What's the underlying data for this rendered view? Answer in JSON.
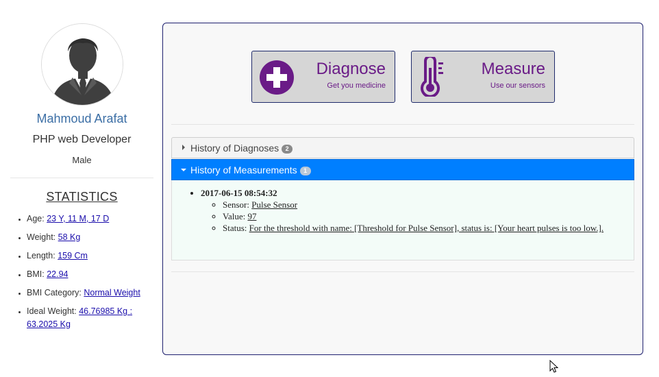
{
  "profile": {
    "name": "Mahmoud Arafat",
    "job_title": "PHP web Developer",
    "gender": "Male"
  },
  "statistics": {
    "title": "STATISTICS",
    "items": [
      {
        "label": "Age:",
        "value": "23 Y, 11 M, 17 D"
      },
      {
        "label": "Weight:",
        "value": "58 Kg"
      },
      {
        "label": "Length:",
        "value": "159 Cm"
      },
      {
        "label": "BMI:",
        "value": "22.94"
      },
      {
        "label": "BMI Category:",
        "value": "Normal Weight"
      },
      {
        "label": "Ideal Weight:",
        "value": "46.76985 Kg : 63.2025 Kg"
      }
    ]
  },
  "actions": {
    "diagnose": {
      "title": "Diagnose",
      "subtitle": "Get you medicine",
      "icon": "plus-circle-icon"
    },
    "measure": {
      "title": "Measure",
      "subtitle": "Use our sensors",
      "icon": "thermometer-icon"
    }
  },
  "accordion": {
    "diagnoses": {
      "label": "History of Diagnoses",
      "count": "2",
      "expanded": false
    },
    "measurements": {
      "label": "History of Measurements",
      "count": "1",
      "expanded": true,
      "entries": [
        {
          "datetime": "2017-06-15 08:54:32",
          "sensor_label": "Sensor:",
          "sensor": "Pulse Sensor",
          "value_label": "Value:",
          "value": "97",
          "status_label": "Status:",
          "status": "For the threshold with name: [Threshold for Pulse Sensor], status is: [Your heart pulses is too low.]."
        }
      ]
    }
  },
  "colors": {
    "accent_purple": "#6a1b87",
    "active_blue": "#007fff",
    "panel_border": "#1d1f6e",
    "name_blue": "#3b6ea5"
  }
}
